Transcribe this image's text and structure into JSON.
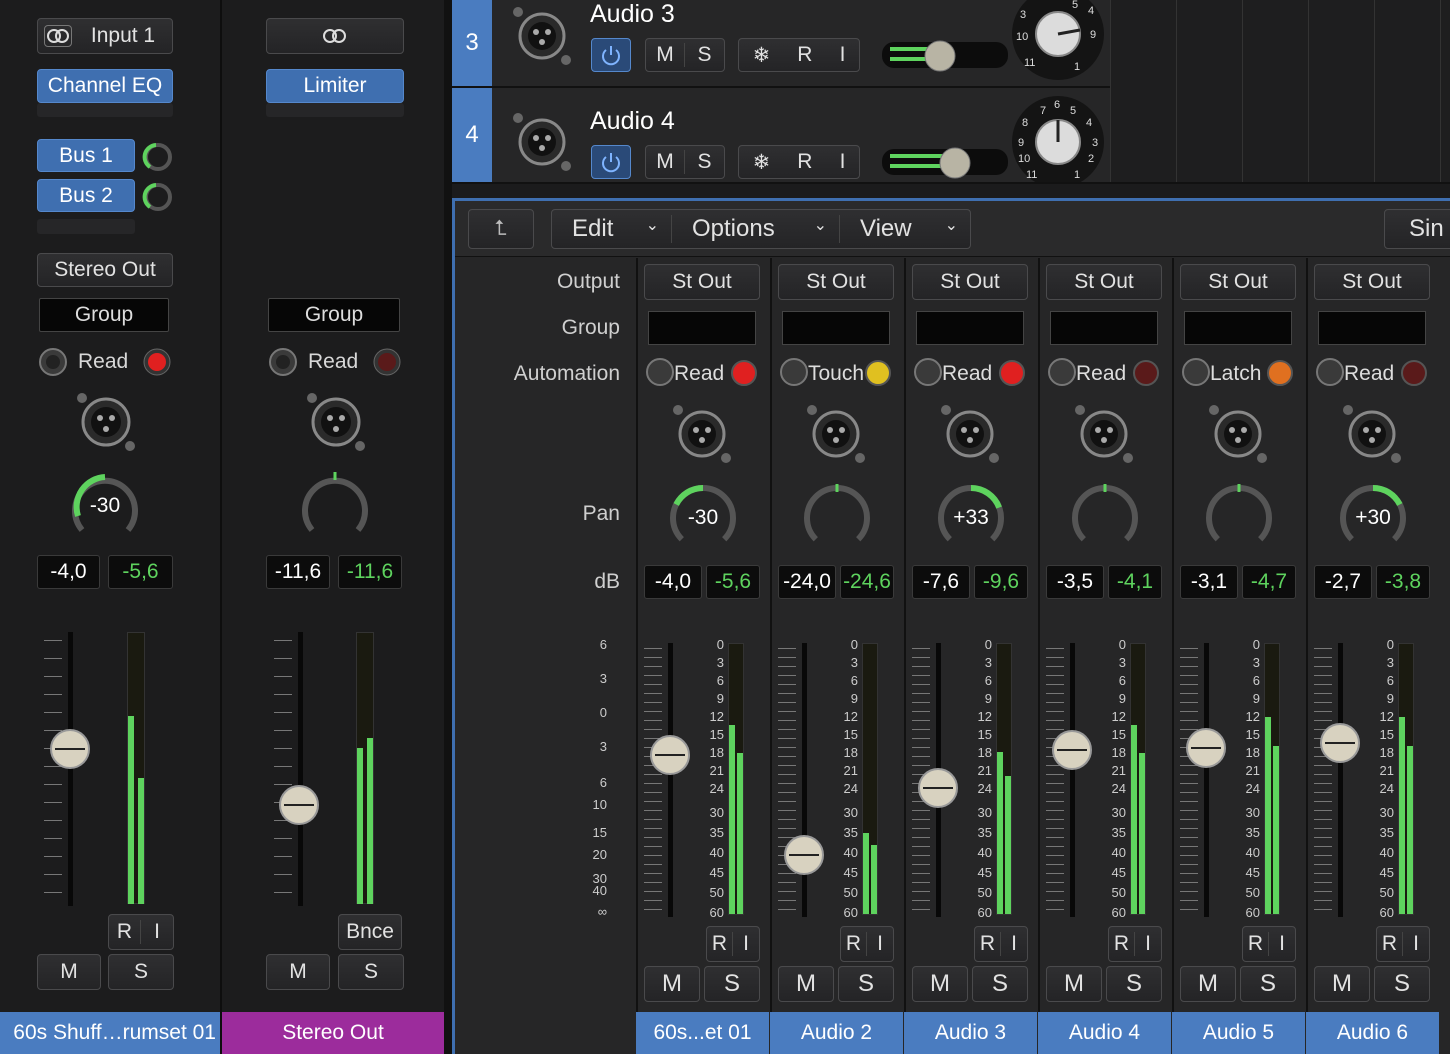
{
  "left_strips": [
    {
      "link_label": "Input 1",
      "plugin": "Channel EQ",
      "sends": [
        "Bus 1",
        "Bus 2"
      ],
      "output": "Stereo Out",
      "group": "Group",
      "automation": "Read",
      "pan": "-30",
      "peak": "-4,0",
      "level": "-5,6",
      "ri": [
        "R",
        "I"
      ],
      "mute": "M",
      "solo": "S",
      "name": "60s Shuff…rumset 01",
      "name_color": "#4a7cc0"
    },
    {
      "link_label": "",
      "plugin": "Limiter",
      "sends": [],
      "output": "",
      "group": "Group",
      "automation": "Read",
      "pan": "",
      "peak": "-11,6",
      "level": "-11,6",
      "extra": "Bnce",
      "mute": "M",
      "solo": "S",
      "name": "Stereo Out",
      "name_color": "#9c2c9c"
    }
  ],
  "tracks": [
    {
      "number": "3",
      "name": "Audio 3",
      "buttons": [
        "M",
        "S",
        "R",
        "I"
      ]
    },
    {
      "number": "4",
      "name": "Audio 4",
      "buttons": [
        "M",
        "S",
        "R",
        "I"
      ]
    }
  ],
  "knob_ticks": [
    "7",
    "6",
    "5",
    "8",
    "4",
    "9",
    "3",
    "10",
    "2",
    "11",
    "1"
  ],
  "editor": {
    "menus": [
      "Edit",
      "Options",
      "View"
    ],
    "right_button": "Sin",
    "row_labels": {
      "output": "Output",
      "group": "Group",
      "automation": "Automation",
      "pan": "Pan",
      "db": "dB"
    },
    "fader_scale": [
      "6",
      "3",
      "0",
      "3",
      "6",
      "10",
      "15",
      "20",
      "30",
      "40",
      "∞"
    ],
    "meter_scale": [
      "0",
      "3",
      "6",
      "9",
      "12",
      "15",
      "18",
      "21",
      "24",
      "30",
      "35",
      "40",
      "45",
      "50",
      "60"
    ],
    "channels": [
      {
        "output": "St Out",
        "automation": "Read",
        "auto_led": "#e02020",
        "pan": "-30",
        "pan_value": -30,
        "peak": "-4,0",
        "level": "-5,6",
        "name": "60s...et 01",
        "fader_pos": 0.42,
        "meter": 0.7
      },
      {
        "output": "St Out",
        "automation": "Touch",
        "auto_led": "#e0c020",
        "pan": "",
        "pan_value": 0,
        "peak": "-24,0",
        "level": "-24,6",
        "name": "Audio 2",
        "fader_pos": 0.82,
        "meter": 0.3
      },
      {
        "output": "St Out",
        "automation": "Read",
        "auto_led": "#e02020",
        "pan": "+33",
        "pan_value": 33,
        "peak": "-7,6",
        "level": "-9,6",
        "name": "Audio 3",
        "fader_pos": 0.55,
        "meter": 0.6
      },
      {
        "output": "St Out",
        "automation": "Read",
        "auto_led": "#5a1a1a",
        "pan": "",
        "pan_value": 0,
        "peak": "-3,5",
        "level": "-4,1",
        "name": "Audio 4",
        "fader_pos": 0.4,
        "meter": 0.7
      },
      {
        "output": "St Out",
        "automation": "Latch",
        "auto_led": "#e07020",
        "pan": "",
        "pan_value": 0,
        "peak": "-3,1",
        "level": "-4,7",
        "name": "Audio 5",
        "fader_pos": 0.39,
        "meter": 0.73
      },
      {
        "output": "St Out",
        "automation": "Read",
        "auto_led": "#5a1a1a",
        "pan": "+30",
        "pan_value": 30,
        "peak": "-2,7",
        "level": "-3,8",
        "name": "Audio 6",
        "fader_pos": 0.37,
        "meter": 0.73
      }
    ],
    "ri": [
      "R",
      "I"
    ],
    "mute": "M",
    "solo": "S"
  }
}
